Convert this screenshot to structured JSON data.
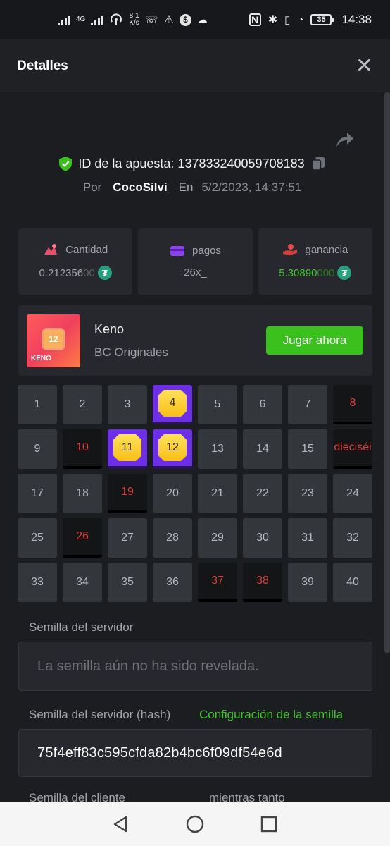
{
  "status_bar": {
    "network": "4G",
    "speed_value": "8,1",
    "speed_unit": "K/s",
    "battery": "35",
    "time": "14:38"
  },
  "header": {
    "title": "Detalles",
    "close_icon": "close-icon"
  },
  "bet": {
    "id_label": "ID de la apuesta: 137833240059708183",
    "by_label": "Por",
    "user": "CocoSilvi",
    "on_label": "En",
    "date": "5/2/2023, 14:37:51"
  },
  "stats": [
    {
      "label": "Cantidad",
      "value_main": "0.212356",
      "value_dim": "00",
      "icon": "bet-amount-icon",
      "currency": "tether-icon"
    },
    {
      "label": "pagos",
      "value_main": "26x_",
      "value_dim": "",
      "icon": "wallet-icon"
    },
    {
      "label": "ganancia",
      "value_main": "5.30890",
      "value_dim": "000",
      "icon": "hand-coin-icon",
      "currency": "tether-icon"
    }
  ],
  "game": {
    "name": "Keno",
    "provider": "BC Originales",
    "thumb_number": "12",
    "thumb_label": "KENO",
    "play_label": "Jugar ahora"
  },
  "grid": [
    {
      "n": "1",
      "s": "normal"
    },
    {
      "n": "2",
      "s": "normal"
    },
    {
      "n": "3",
      "s": "normal"
    },
    {
      "n": "4",
      "s": "hit"
    },
    {
      "n": "5",
      "s": "normal"
    },
    {
      "n": "6",
      "s": "normal"
    },
    {
      "n": "7",
      "s": "normal"
    },
    {
      "n": "8",
      "s": "miss"
    },
    {
      "n": "9",
      "s": "normal"
    },
    {
      "n": "10",
      "s": "miss"
    },
    {
      "n": "11",
      "s": "hit"
    },
    {
      "n": "12",
      "s": "hit"
    },
    {
      "n": "13",
      "s": "normal"
    },
    {
      "n": "14",
      "s": "normal"
    },
    {
      "n": "15",
      "s": "normal"
    },
    {
      "n": "dieciséi",
      "s": "miss"
    },
    {
      "n": "17",
      "s": "normal"
    },
    {
      "n": "18",
      "s": "normal"
    },
    {
      "n": "19",
      "s": "miss"
    },
    {
      "n": "20",
      "s": "normal"
    },
    {
      "n": "21",
      "s": "normal"
    },
    {
      "n": "22",
      "s": "normal"
    },
    {
      "n": "23",
      "s": "normal"
    },
    {
      "n": "24",
      "s": "normal"
    },
    {
      "n": "25",
      "s": "normal"
    },
    {
      "n": "26",
      "s": "miss"
    },
    {
      "n": "27",
      "s": "normal"
    },
    {
      "n": "28",
      "s": "normal"
    },
    {
      "n": "29",
      "s": "normal"
    },
    {
      "n": "30",
      "s": "normal"
    },
    {
      "n": "31",
      "s": "normal"
    },
    {
      "n": "32",
      "s": "normal"
    },
    {
      "n": "33",
      "s": "normal"
    },
    {
      "n": "34",
      "s": "normal"
    },
    {
      "n": "35",
      "s": "normal"
    },
    {
      "n": "36",
      "s": "normal"
    },
    {
      "n": "37",
      "s": "miss"
    },
    {
      "n": "38",
      "s": "miss"
    },
    {
      "n": "39",
      "s": "normal"
    },
    {
      "n": "40",
      "s": "normal"
    }
  ],
  "seeds": {
    "server_label": "Semilla del servidor",
    "server_value": "La semilla aún no ha sido revelada.",
    "hash_label": "Semilla del servidor (hash)",
    "config_link": "Configuración de la semilla",
    "hash_value": "75f4eff83c595cfda82b4bc6f09df54e6d",
    "client_label": "Semilla del cliente",
    "nonce_label": "mientras tanto"
  },
  "colors": {
    "accent_green": "#3bc11d",
    "hit_purple": "#6d2ee8",
    "miss_red": "#e03a3a"
  }
}
